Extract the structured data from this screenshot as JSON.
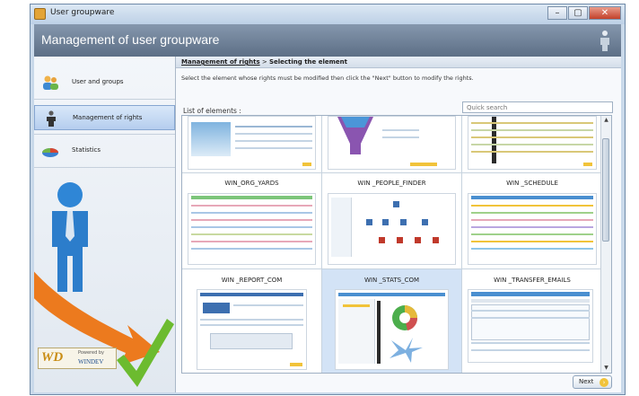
{
  "window": {
    "title": "User groupware",
    "controls": {
      "minimize": "–",
      "maximize": "▢",
      "close": "✕"
    }
  },
  "header": {
    "title": "Management of user groupware"
  },
  "sidebar": {
    "items": [
      {
        "label": "User and groups",
        "icon": "users-icon"
      },
      {
        "label": "Management of rights",
        "icon": "figure-icon",
        "active": true
      },
      {
        "label": "Statistics",
        "icon": "pie-chart-icon"
      }
    ],
    "logo": {
      "initials": "WD",
      "powered_by": "Powered by",
      "product": "WINDEV"
    }
  },
  "breadcrumb": {
    "link": "Management of rights",
    "separator": " > ",
    "current": "Selecting the element"
  },
  "instruction": "Select the element whose rights must be modified then click the \"Next\" button to modify the rights.",
  "list": {
    "label": "List of elements :",
    "search_placeholder": "Quick search",
    "items": [
      {
        "title": "",
        "selected": false
      },
      {
        "title": "",
        "selected": false
      },
      {
        "title": "",
        "selected": false
      },
      {
        "title": "WIN_ORG_YARDS",
        "selected": false
      },
      {
        "title": "WIN _PEOPLE_FINDER",
        "selected": false
      },
      {
        "title": "WIN _SCHEDULE",
        "selected": false
      },
      {
        "title": "WIN _REPORT_COM",
        "selected": false
      },
      {
        "title": "WIN _STATS_COM",
        "selected": true
      },
      {
        "title": "WIN _TRANSFER_EMAILS",
        "selected": false
      }
    ]
  },
  "buttons": {
    "next": "Next"
  },
  "colors": {
    "header": "#6b7d94",
    "selection": "#d3e3f6",
    "accent": "#f1c33a"
  }
}
